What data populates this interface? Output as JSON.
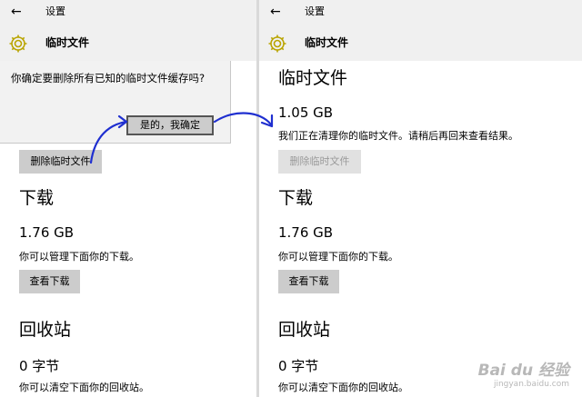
{
  "left": {
    "header": {
      "back_icon": "←",
      "title": "设置",
      "subtitle": "临时文件"
    },
    "dialog": {
      "text": "你确定要删除所有已知的临时文件缓存吗?",
      "confirm": "是的，我确定"
    },
    "delete_button": "删除临时文件",
    "downloads": {
      "heading": "下载",
      "size": "1.76 GB",
      "note": "你可以管理下面你的下载。",
      "button": "查看下载"
    },
    "recycle": {
      "heading": "回收站",
      "size": "0 字节",
      "note": "你可以清空下面你的回收站。"
    }
  },
  "right": {
    "header": {
      "back_icon": "←",
      "title": "设置",
      "subtitle": "临时文件"
    },
    "temp": {
      "heading": "临时文件",
      "size": "1.05 GB",
      "note": "我们正在清理你的临时文件。请稍后再回来查看结果。",
      "button": "删除临时文件"
    },
    "downloads": {
      "heading": "下载",
      "size": "1.76 GB",
      "note": "你可以管理下面你的下载。",
      "button": "查看下载"
    },
    "recycle": {
      "heading": "回收站",
      "size": "0 字节",
      "note": "你可以清空下面你的回收站。"
    }
  },
  "watermark": {
    "logo": "Bai du 经验",
    "url": "jingyan.baidu.com"
  },
  "icons": {
    "settings": "gear-icon",
    "back": "back-arrow-icon",
    "annotation": "curved-arrow-icon"
  },
  "colors": {
    "header_bg": "#f0f0f0",
    "button_bg": "#cccccc",
    "gear": "#b9a400",
    "annotation": "#1f2fd0"
  }
}
